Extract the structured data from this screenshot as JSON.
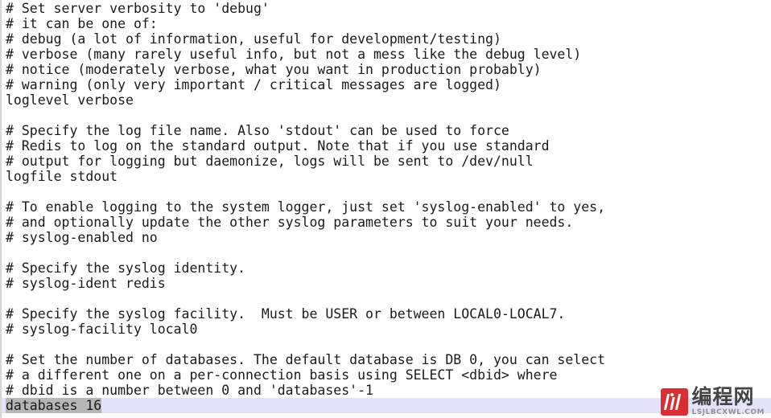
{
  "editor": {
    "background_color": "#ffffff",
    "text_color": "#1a1a1a",
    "current_line_highlight_color": "#e4e2fa",
    "selection_color": "#b6b6b6",
    "gutter_border_color": "#d6d6d6"
  },
  "lines": [
    {
      "text": "# Set server verbosity to 'debug'",
      "current": false
    },
    {
      "text": "# it can be one of:",
      "current": false
    },
    {
      "text": "# debug (a lot of information, useful for development/testing)",
      "current": false
    },
    {
      "text": "# verbose (many rarely useful info, but not a mess like the debug level)",
      "current": false
    },
    {
      "text": "# notice (moderately verbose, what you want in production probably)",
      "current": false
    },
    {
      "text": "# warning (only very important / critical messages are logged)",
      "current": false
    },
    {
      "text": "loglevel verbose",
      "current": false
    },
    {
      "text": "",
      "current": false
    },
    {
      "text": "# Specify the log file name. Also 'stdout' can be used to force",
      "current": false
    },
    {
      "text": "# Redis to log on the standard output. Note that if you use standard",
      "current": false
    },
    {
      "text": "# output for logging but daemonize, logs will be sent to /dev/null",
      "current": false
    },
    {
      "text": "logfile stdout",
      "current": false
    },
    {
      "text": "",
      "current": false
    },
    {
      "text": "# To enable logging to the system logger, just set 'syslog-enabled' to yes,",
      "current": false
    },
    {
      "text": "# and optionally update the other syslog parameters to suit your needs.",
      "current": false
    },
    {
      "text": "# syslog-enabled no",
      "current": false
    },
    {
      "text": "",
      "current": false
    },
    {
      "text": "# Specify the syslog identity.",
      "current": false
    },
    {
      "text": "# syslog-ident redis",
      "current": false
    },
    {
      "text": "",
      "current": false
    },
    {
      "text": "# Specify the syslog facility.  Must be USER or between LOCAL0-LOCAL7.",
      "current": false
    },
    {
      "text": "# syslog-facility local0",
      "current": false
    },
    {
      "text": "",
      "current": false
    },
    {
      "text": "# Set the number of databases. The default database is DB 0, you can select",
      "current": false
    },
    {
      "text": "# a different one on a per-connection basis using SELECT <dbid> where",
      "current": false
    },
    {
      "text": "# dbid is a number between 0 and 'databases'-1",
      "current": false
    },
    {
      "text": "databases 16",
      "current": true
    }
  ],
  "watermark": {
    "logo_color": "#d9252a",
    "title": "编程网",
    "subtitle": "LSJLBCXWL.COM"
  }
}
